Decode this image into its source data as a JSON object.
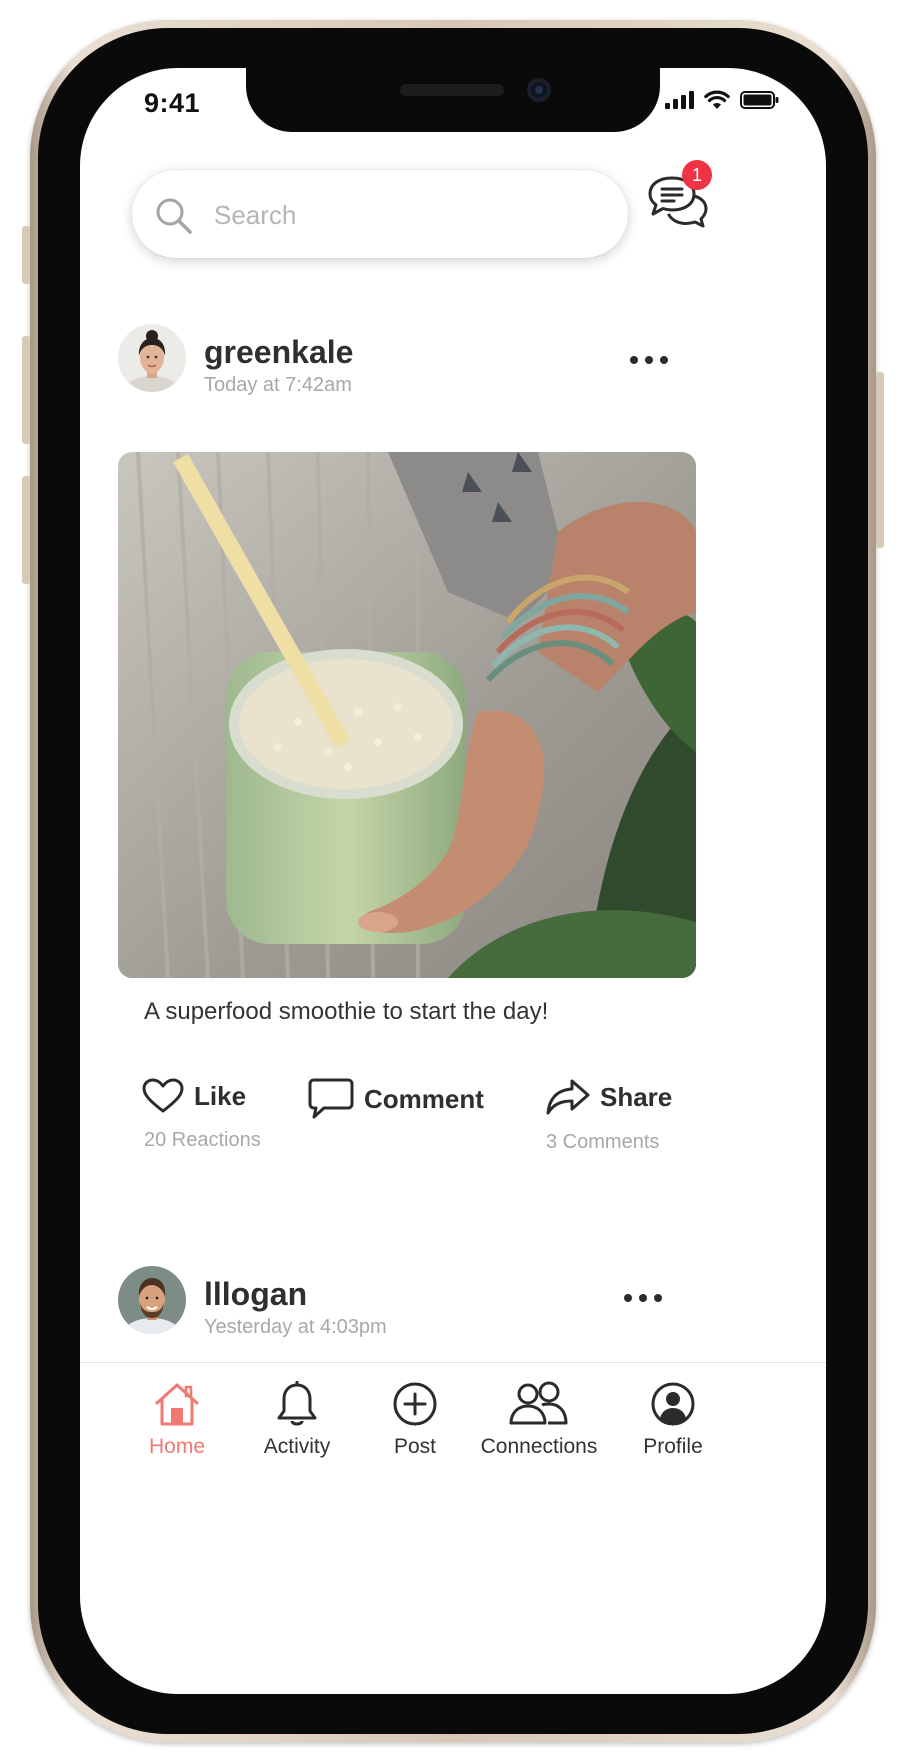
{
  "status_bar": {
    "time": "9:41"
  },
  "search": {
    "placeholder": "Search"
  },
  "messages": {
    "badge_count": "1"
  },
  "colors": {
    "accent": "#f07a72",
    "badge": "#ee3344",
    "muted_text": "#a8a8a8"
  },
  "posts": [
    {
      "username": "greenkale",
      "timestamp": "Today at 7:42am",
      "caption": "A superfood smoothie to start the day!",
      "actions": {
        "like": "Like",
        "comment": "Comment",
        "share": "Share"
      },
      "reactions": "20 Reactions",
      "comments": "3 Comments"
    },
    {
      "username": "lllogan",
      "timestamp": "Yesterday at 4:03pm"
    }
  ],
  "tab_bar": {
    "active": "Home",
    "items": [
      {
        "label": "Home",
        "icon": "home-icon"
      },
      {
        "label": "Activity",
        "icon": "bell-icon"
      },
      {
        "label": "Post",
        "icon": "plus-circle-icon"
      },
      {
        "label": "Connections",
        "icon": "people-icon"
      },
      {
        "label": "Profile",
        "icon": "profile-icon"
      }
    ]
  }
}
